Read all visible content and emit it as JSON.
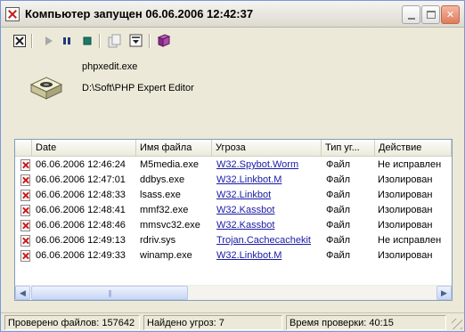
{
  "window": {
    "title": "Компьютер запущен 06.06.2006 12:42:37",
    "title_icon": "close-x-icon"
  },
  "toolbar": {
    "items": [
      {
        "name": "close-report-icon",
        "enabled": true
      },
      {
        "name": "play-icon",
        "enabled": false
      },
      {
        "name": "pause-icon",
        "enabled": true
      },
      {
        "name": "stop-icon",
        "enabled": true
      },
      {
        "name": "copy-icon",
        "enabled": false
      },
      {
        "name": "save-icon",
        "enabled": true
      },
      {
        "name": "book-icon",
        "enabled": true
      }
    ]
  },
  "file": {
    "name": "phpxedit.exe",
    "path": "D:\\Soft\\PHP Expert Editor",
    "icon": "application-icon"
  },
  "list": {
    "columns": [
      "Date",
      "Имя файла",
      "Угроза",
      "Тип уг...",
      "Действие"
    ],
    "rows": [
      {
        "date": "06.06.2006 12:46:24",
        "file": "M5media.exe",
        "threat": "W32.Spybot.Worm",
        "type": "Файл",
        "action": "Не исправлен"
      },
      {
        "date": "06.06.2006 12:47:01",
        "file": "ddbys.exe",
        "threat": "W32.Linkbot.M",
        "type": "Файл",
        "action": "Изолирован"
      },
      {
        "date": "06.06.2006 12:48:33",
        "file": "lsass.exe",
        "threat": "W32.Linkbot",
        "type": "Файл",
        "action": "Изолирован"
      },
      {
        "date": "06.06.2006 12:48:41",
        "file": "mmf32.exe",
        "threat": "W32.Kassbot",
        "type": "Файл",
        "action": "Изолирован"
      },
      {
        "date": "06.06.2006 12:48:46",
        "file": "mmsvc32.exe",
        "threat": "W32.Kassbot",
        "type": "Файл",
        "action": "Изолирован"
      },
      {
        "date": "06.06.2006 12:49:13",
        "file": "rdriv.sys",
        "threat": "Trojan.Cachecachekit",
        "type": "Файл",
        "action": "Не исправлен"
      },
      {
        "date": "06.06.2006 12:49:33",
        "file": "winamp.exe",
        "threat": "W32.Linkbot.M",
        "type": "Файл",
        "action": "Изолирован"
      }
    ]
  },
  "statusbar": {
    "files_checked": "Проверено файлов: 157642",
    "threats_found": "Найдено угроз: 7",
    "scan_time": "Время проверки: 40:15"
  },
  "colors": {
    "threat_link": "#1a1aa6",
    "row_icon": "#cc1a1a"
  }
}
